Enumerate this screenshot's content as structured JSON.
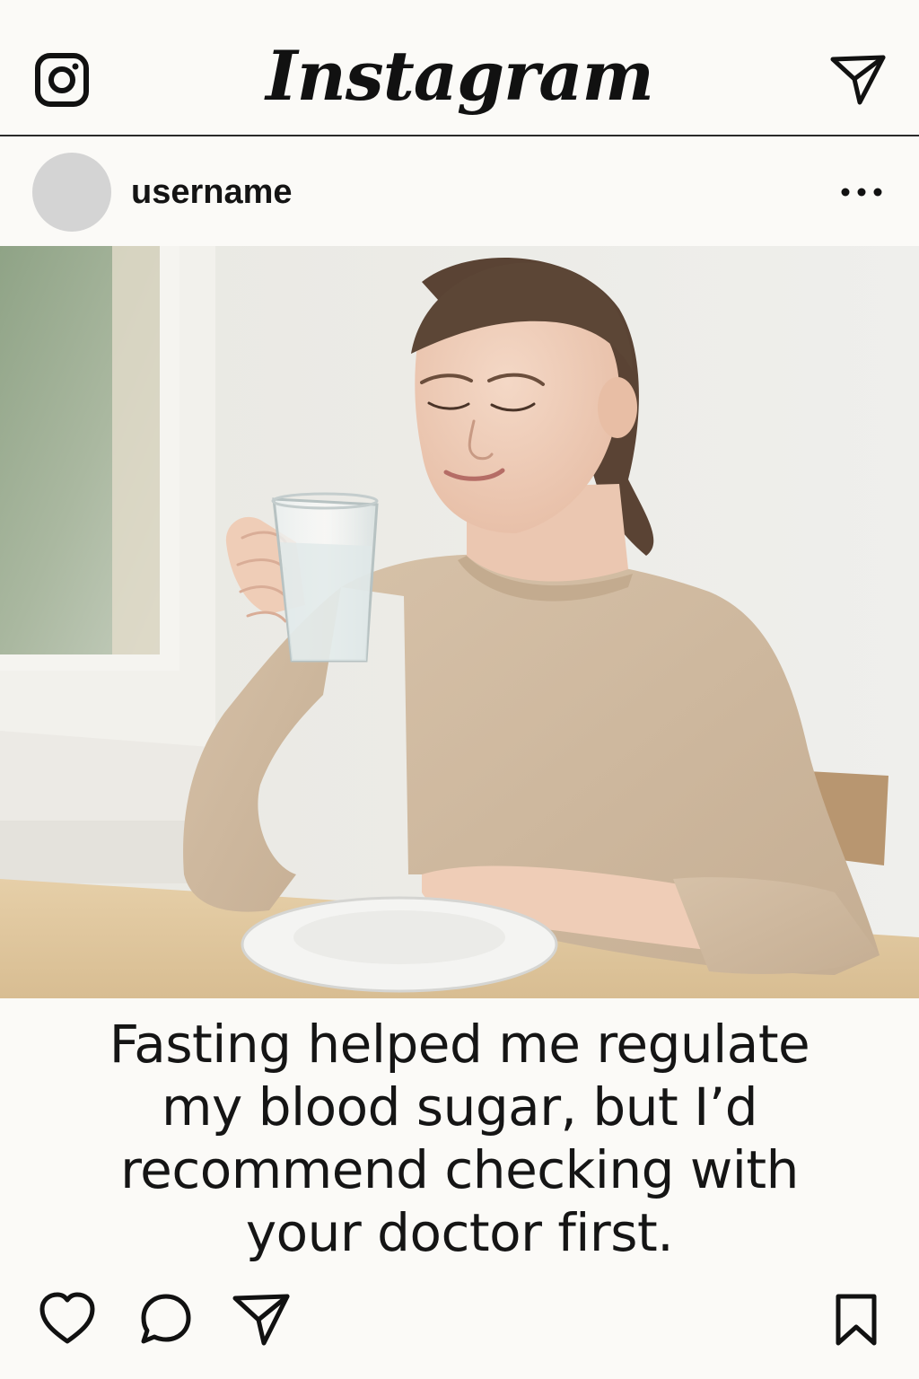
{
  "app": {
    "brand_title": "Instagram",
    "icons": {
      "left": "instagram-logo-icon",
      "right": "direct-message-icon"
    }
  },
  "post": {
    "username": "username",
    "avatar": "avatar-placeholder",
    "menu_icon": "more-options-icon",
    "image_alt": "photo",
    "caption_lines": [
      "Fasting helped me regulate",
      "my blood sugar, but I’d",
      "recommend checking with",
      "your doctor first."
    ],
    "actions": [
      "like-icon",
      "comment-icon",
      "share-icon",
      "bookmark-icon"
    ]
  },
  "colors": {
    "background": "#fbfaf7",
    "text": "#111111",
    "avatar": "#d4d4d4",
    "divider": "#2a2a2a"
  }
}
